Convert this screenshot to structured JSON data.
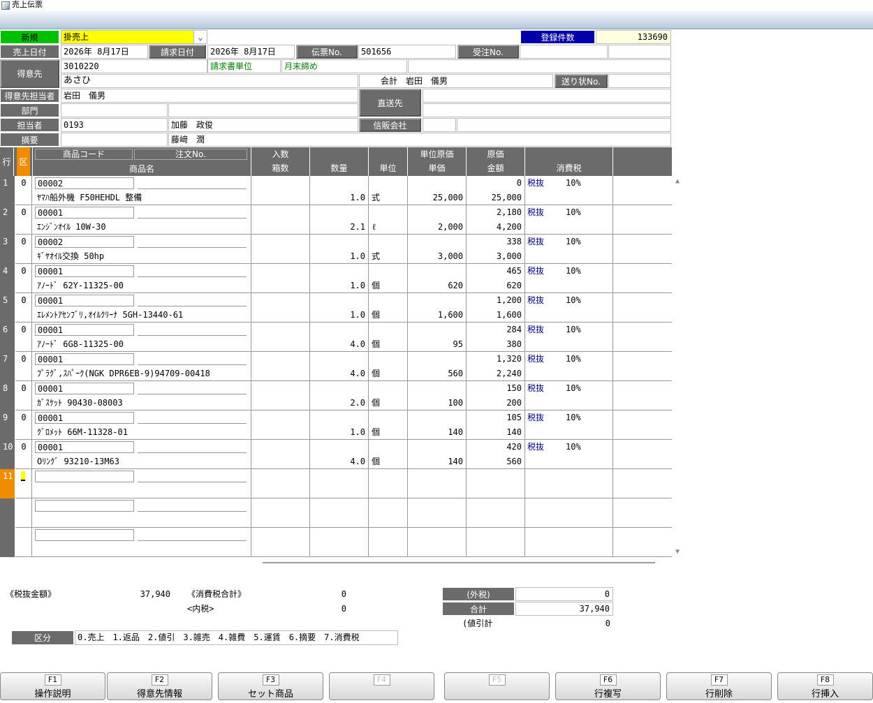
{
  "window": {
    "title": "売上伝票"
  },
  "header": {
    "mode_label": "新規",
    "sales_type": "掛売上",
    "reg_count_label": "登録件数",
    "reg_count": "133690",
    "sales_date_label": "売上日付",
    "sales_date": "2026年 8月17日",
    "billing_date_label": "請求日付",
    "billing_date": "2026年 8月17日",
    "slip_no_label": "伝票No.",
    "slip_no": "501656",
    "order_no_label": "受注No.",
    "order_no": "",
    "customer_label": "得意先",
    "customer_code": "3010220",
    "billing_unit_label": "請求書単位",
    "closing": "月末締め",
    "customer_name": "あさひ",
    "accounting": "会計　岩田　儀男",
    "invoice_no_label": "送り状No.",
    "customer_staff_label": "得意先担当者",
    "customer_staff": "岩田　儀男",
    "direct_ship_label": "直送先",
    "dept_label": "部門",
    "staff_label": "担当者",
    "staff_code": "0193",
    "staff_name": "加藤　政俊",
    "credit_label": "信販会社",
    "memo_label": "摘要",
    "memo_name": "藤﨑　潤"
  },
  "grid": {
    "headers": {
      "row": "行",
      "kind": "区",
      "code": "商品コード",
      "order_no": "注文No.",
      "name": "商品名",
      "qty_per_box": "入数",
      "boxes": "箱数",
      "qty": "数量",
      "unit": "単位",
      "cost_price": "単位原価",
      "unit_price": "単価",
      "cost": "原価",
      "amount": "金額",
      "tax": "消費税"
    },
    "rows": [
      {
        "no": "1",
        "kind": "0",
        "code": "00002",
        "name": "ﾔﾏﾊ船外機 F50HEHDL 整備",
        "qty": "1.0",
        "unit": "式",
        "price": "25,000",
        "cost": "0",
        "amount": "25,000",
        "tax_type": "税抜",
        "tax_rate": "10%"
      },
      {
        "no": "2",
        "kind": "0",
        "code": "00001",
        "name": "ｴﾝｼﾞﾝｵｲﾙ 10W-30",
        "qty": "2.1",
        "unit": "ℓ",
        "price": "2,000",
        "cost": "2,180",
        "amount": "4,200",
        "tax_type": "税抜",
        "tax_rate": "10%"
      },
      {
        "no": "3",
        "kind": "0",
        "code": "00002",
        "name": "ｷﾞﾔｵｲﾙ交換 50hp",
        "qty": "1.0",
        "unit": "式",
        "price": "3,000",
        "cost": "338",
        "amount": "3,000",
        "tax_type": "税抜",
        "tax_rate": "10%"
      },
      {
        "no": "4",
        "kind": "0",
        "code": "00001",
        "name": "ｱﾉｰﾄﾞ 62Y-11325-00",
        "qty": "1.0",
        "unit": "個",
        "price": "620",
        "cost": "465",
        "amount": "620",
        "tax_type": "税抜",
        "tax_rate": "10%"
      },
      {
        "no": "5",
        "kind": "0",
        "code": "00001",
        "name": "ｴﾚﾒﾝﾄｱｾﾝﾌﾞﾘ,ｵｲﾙｸﾘｰﾅ 5GH-13440-61",
        "qty": "1.0",
        "unit": "個",
        "price": "1,600",
        "cost": "1,200",
        "amount": "1,600",
        "tax_type": "税抜",
        "tax_rate": "10%"
      },
      {
        "no": "6",
        "kind": "0",
        "code": "00001",
        "name": "ｱﾉｰﾄﾞ 6G8-11325-00",
        "qty": "4.0",
        "unit": "個",
        "price": "95",
        "cost": "284",
        "amount": "380",
        "tax_type": "税抜",
        "tax_rate": "10%"
      },
      {
        "no": "7",
        "kind": "0",
        "code": "00001",
        "name": "ﾌﾟﾗｸﾞ,ｽﾊﾟｰｸ(NGK DPR6EB-9)94709-00418",
        "qty": "4.0",
        "unit": "個",
        "price": "560",
        "cost": "1,320",
        "amount": "2,240",
        "tax_type": "税抜",
        "tax_rate": "10%"
      },
      {
        "no": "8",
        "kind": "0",
        "code": "00001",
        "name": "ｶﾞｽｹｯﾄ 90430-08003",
        "qty": "2.0",
        "unit": "個",
        "price": "100",
        "cost": "150",
        "amount": "200",
        "tax_type": "税抜",
        "tax_rate": "10%"
      },
      {
        "no": "9",
        "kind": "0",
        "code": "00001",
        "name": "ｸﾞﾛﾒｯﾄ 66M-11328-01",
        "qty": "1.0",
        "unit": "個",
        "price": "140",
        "cost": "105",
        "amount": "140",
        "tax_type": "税抜",
        "tax_rate": "10%"
      },
      {
        "no": "10",
        "kind": "0",
        "code": "00001",
        "name": "Oﾘﾝｸﾞ 93210-13M63",
        "qty": "4.0",
        "unit": "個",
        "price": "140",
        "cost": "420",
        "amount": "560",
        "tax_type": "税抜",
        "tax_rate": "10%"
      },
      {
        "no": "11",
        "kind": "",
        "code": "",
        "name": "",
        "qty": "",
        "unit": "",
        "price": "",
        "cost": "",
        "amount": "",
        "tax_type": "",
        "tax_rate": ""
      },
      {
        "no": "",
        "kind": "",
        "code": "",
        "name": "",
        "qty": "",
        "unit": "",
        "price": "",
        "cost": "",
        "amount": "",
        "tax_type": "",
        "tax_rate": ""
      },
      {
        "no": "",
        "kind": "",
        "code": "",
        "name": "",
        "qty": "",
        "unit": "",
        "price": "",
        "cost": "",
        "amount": "",
        "tax_type": "",
        "tax_rate": ""
      }
    ]
  },
  "totals": {
    "pretax_label": "《税抜金額》",
    "pretax": "37,940",
    "tax_total_label": "《消費税合計》",
    "tax_total": "0",
    "inner_tax_label": "<内税>",
    "inner_tax": "0",
    "outer_tax_label": "(外税)",
    "outer_tax": "0",
    "total_label": "合計",
    "total": "37,940",
    "discount_label": "(値引計",
    "discount": "0"
  },
  "category": {
    "label": "区分",
    "legend": "0.売上　1.返品　2.値引　3.雑売　4.雑費　5.運賃　6.摘要　7.消費税"
  },
  "fkeys": [
    {
      "key": "F1",
      "label": "操作説明"
    },
    {
      "key": "F2",
      "label": "得意先情報"
    },
    {
      "key": "F3",
      "label": "セット商品"
    },
    {
      "key": "F4",
      "label": ""
    },
    {
      "key": "F5",
      "label": ""
    },
    {
      "key": "F6",
      "label": "行複写"
    },
    {
      "key": "F7",
      "label": "行削除"
    },
    {
      "key": "F8",
      "label": "行挿入"
    }
  ]
}
